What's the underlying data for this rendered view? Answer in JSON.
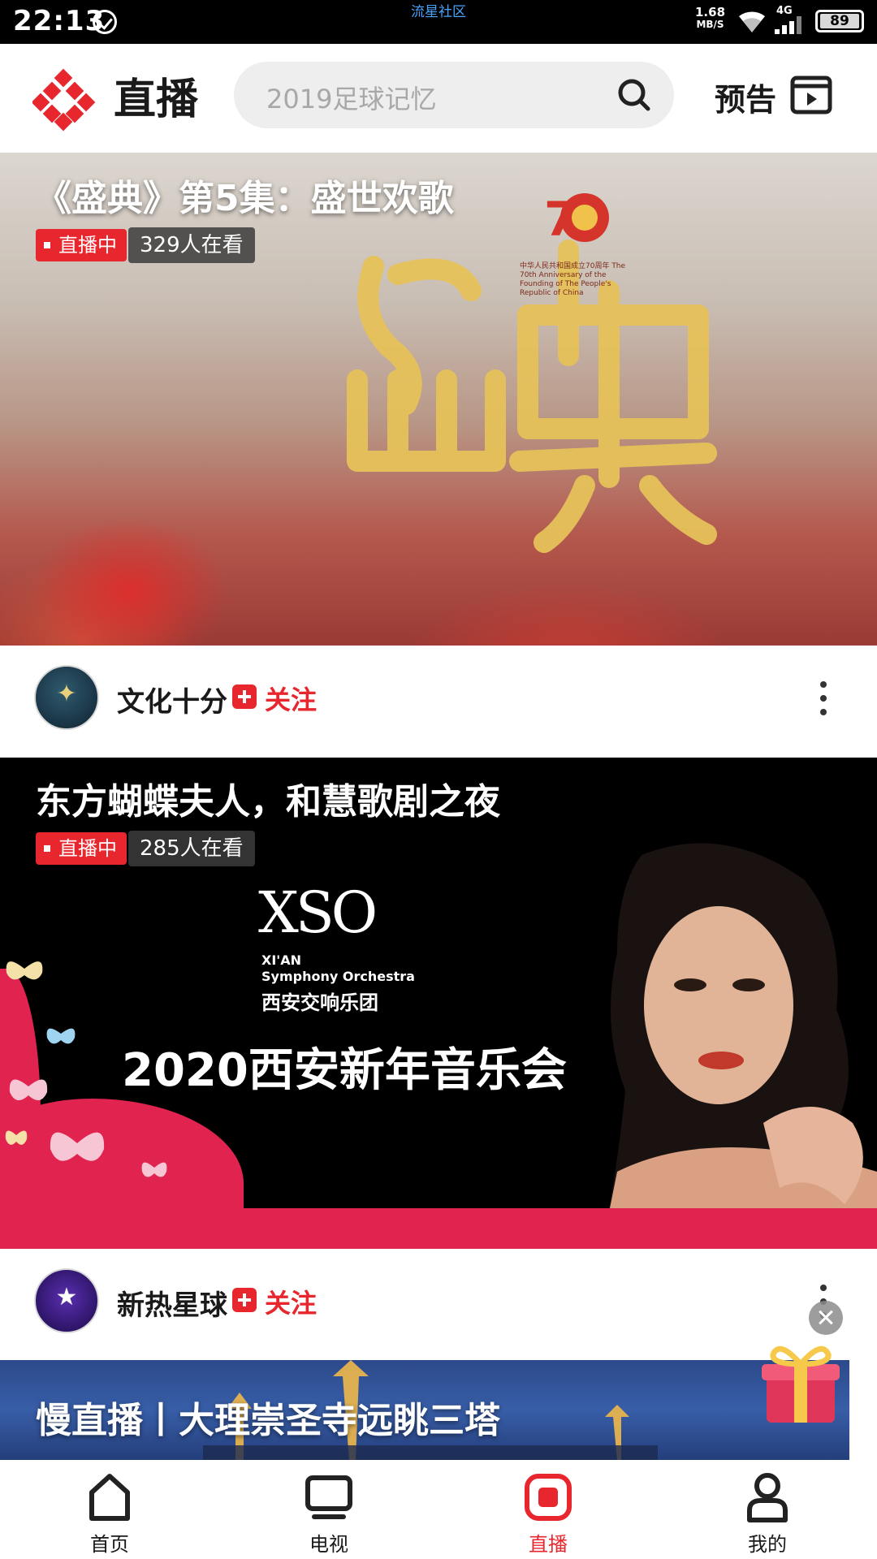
{
  "status_bar": {
    "time": "22:13",
    "center_text": "流星社区",
    "speed_value": "1.68",
    "speed_unit": "MB/S",
    "network": "4G",
    "battery": "89"
  },
  "header": {
    "app_title": "直播",
    "search_placeholder": "2019足球记忆",
    "preview_label": "预告"
  },
  "cards": [
    {
      "title": "《盛典》第5集：盛世欢歌",
      "live_badge": "直播中",
      "viewers": "329人在看",
      "channel": "文化十分",
      "follow_label": "关注",
      "emblem_caption": "中华人民共和国成立70周年 The 70th Anniversary of the Founding of The People's Republic of China"
    },
    {
      "title": "东方蝴蝶夫人，和慧歌剧之夜",
      "live_badge": "直播中",
      "viewers": "285人在看",
      "channel": "新热星球",
      "follow_label": "关注",
      "poster_logo": "XSO",
      "poster_line1": "XI'AN",
      "poster_line2": "Symphony Orchestra",
      "poster_line3": "西安交响乐团",
      "poster_title": "2020西安新年音乐会"
    },
    {
      "title": "慢直播丨大理崇圣寺远眺三塔"
    }
  ],
  "bottom_nav": [
    {
      "label": "首页",
      "icon": "home-icon",
      "active": false
    },
    {
      "label": "电视",
      "icon": "tv-icon",
      "active": false
    },
    {
      "label": "直播",
      "icon": "live-icon",
      "active": true
    },
    {
      "label": "我的",
      "icon": "profile-icon",
      "active": false
    }
  ],
  "colors": {
    "accent": "#e8262d",
    "poster_pink": "#e1234f",
    "gold": "#e6c25a"
  }
}
